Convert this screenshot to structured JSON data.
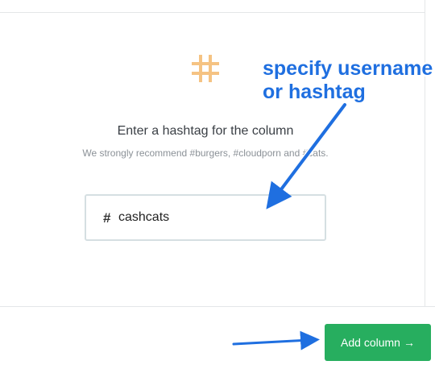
{
  "dialog": {
    "title": "Enter a hashtag for the column",
    "subtitle": "We strongly recommend #burgers, #cloudporn and #cats.",
    "input": {
      "prefix": "#",
      "value": "cashcats"
    },
    "add_button": {
      "label": "Add column",
      "arrow": "→"
    }
  },
  "annotation": {
    "line1": "specify username",
    "line2": "or hashtag",
    "color": "#1f6fe0"
  },
  "icons": {
    "main": "hashtag-icon",
    "accent_color": "#f5c383"
  },
  "colors": {
    "button_green": "#27ae5f"
  }
}
